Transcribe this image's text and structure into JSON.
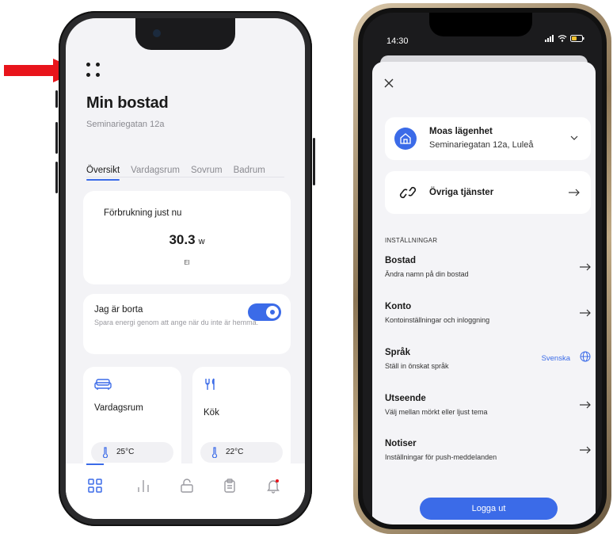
{
  "left_screen": {
    "title": "Min bostad",
    "address": "Seminariegatan 12a",
    "tabs": [
      "Översikt",
      "Vardagsrum",
      "Sovrum",
      "Badrum"
    ],
    "consumption": {
      "title": "Förbrukning just nu",
      "value": "30.3",
      "unit": "w",
      "type": "El"
    },
    "away": {
      "title": "Jag är borta",
      "description": "Spara energi genom att ange när du inte är hemma.",
      "enabled": true
    },
    "rooms": [
      {
        "name": "Vardagsrum",
        "icon": "sofa-icon",
        "temperature": "25°C"
      },
      {
        "name": "Kök",
        "icon": "utensils-icon",
        "temperature": "22°C"
      }
    ],
    "bottom_nav": [
      "grid-icon",
      "bar-chart-icon",
      "unlock-icon",
      "clipboard-icon",
      "bell-icon"
    ]
  },
  "right_screen": {
    "status_time": "14:30",
    "home": {
      "name": "Moas lägenhet",
      "address": "Seminariegatan 12a, Luleå"
    },
    "services_label": "Övriga tjänster",
    "section_title": "INSTÄLLNINGAR",
    "settings": [
      {
        "title": "Bostad",
        "desc": "Ändra namn på din bostad"
      },
      {
        "title": "Konto",
        "desc": "Kontoinställningar och inloggning"
      },
      {
        "title": "Språk",
        "desc": "Ställ in önskat språk",
        "value": "Svenska"
      },
      {
        "title": "Utseende",
        "desc": "Välj mellan mörkt eller ljust tema"
      },
      {
        "title": "Notiser",
        "desc": "Inställningar för push-meddelanden"
      }
    ],
    "logout_label": "Logga ut"
  },
  "colors": {
    "accent": "#3b6be8",
    "arrow": "#e8141b"
  }
}
